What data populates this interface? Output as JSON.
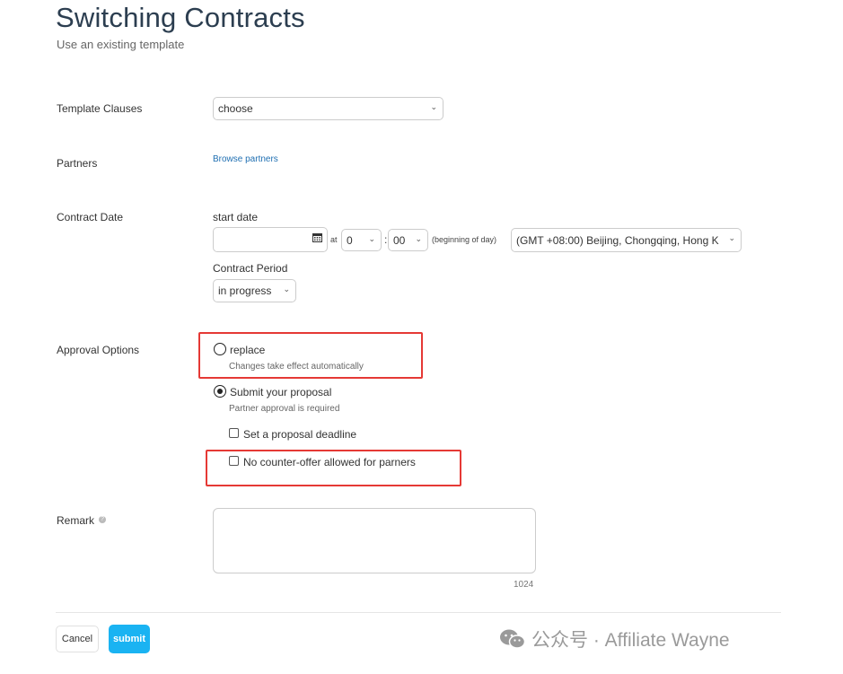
{
  "header": {
    "title": "Switching Contracts",
    "subtitle": "Use an existing template"
  },
  "form": {
    "template_clauses": {
      "label": "Template Clauses",
      "value": "choose"
    },
    "partners": {
      "label": "Partners",
      "link": "Browse partners"
    },
    "contract_date": {
      "label": "Contract Date",
      "start_date_label": "start date",
      "date_value": "",
      "at_label": "at",
      "hour": "0",
      "colon": ":",
      "minute": "00",
      "beginning_note": "(beginning of day)",
      "timezone": "(GMT +08:00) Beijing, Chongqing, Hong K",
      "period_label": "Contract Period",
      "period_value": "in progress"
    },
    "approval": {
      "label": "Approval Options",
      "options": [
        {
          "label": "replace",
          "hint": "Changes take effect automatically",
          "checked": false
        },
        {
          "label": "Submit your proposal",
          "hint": "Partner approval is required",
          "checked": true
        }
      ],
      "checkboxes": [
        {
          "label": "Set a proposal deadline",
          "checked": false
        },
        {
          "label": "No counter-offer allowed for parners",
          "checked": false
        }
      ]
    },
    "remark": {
      "label": "Remark",
      "value": "",
      "max_length": "1024"
    }
  },
  "footer": {
    "cancel_label": "Cancel",
    "submit_label": "submit"
  },
  "watermark": {
    "text": "公众号 · Affiliate Wayne"
  },
  "colors": {
    "accent": "#1ab3f2",
    "link": "#1f6fb2",
    "highlight": "#e53935",
    "title": "#2c3e50"
  }
}
